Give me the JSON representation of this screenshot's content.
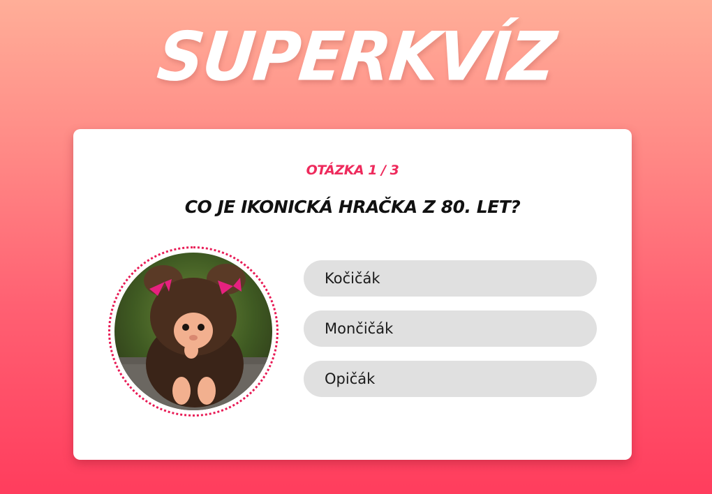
{
  "app": {
    "logo": "SUPERKVÍZ"
  },
  "quiz": {
    "counter": "Otázka 1 / 3",
    "question": "Co je ikonická hračka z 80. let?",
    "answers": [
      {
        "label": "Kočičák"
      },
      {
        "label": "Mončičák"
      },
      {
        "label": "Opičák"
      }
    ]
  },
  "colors": {
    "accent": "#ee2a5c",
    "answer_bg": "#e0e0e0",
    "gradient_top": "#ffae98",
    "gradient_bottom": "#ff3d5d"
  }
}
